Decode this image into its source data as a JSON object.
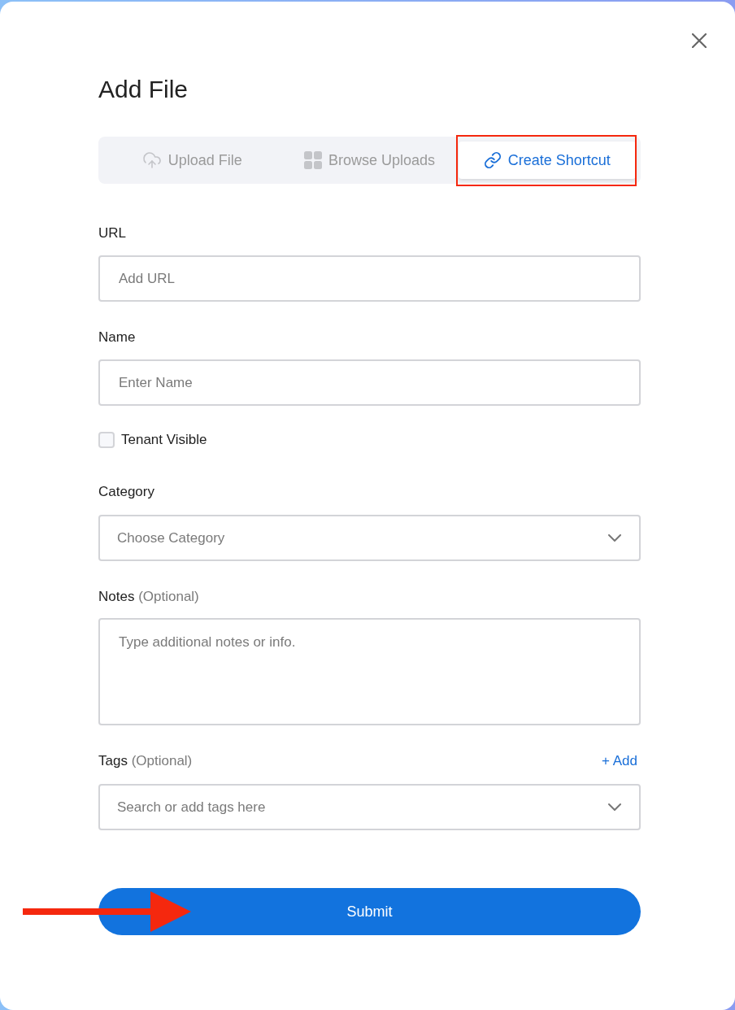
{
  "dialog": {
    "title": "Add File"
  },
  "tabs": [
    {
      "label": "Upload File",
      "selected": false,
      "highlighted": false
    },
    {
      "label": "Browse Uploads",
      "selected": false,
      "highlighted": false
    },
    {
      "label": "Create Shortcut",
      "selected": true,
      "highlighted": true
    }
  ],
  "fields": [
    {
      "kind": "text",
      "label": "URL",
      "placeholder": "Add URL"
    },
    {
      "kind": "text",
      "label": "Name",
      "placeholder": "Enter Name"
    },
    {
      "kind": "checkbox",
      "label": "Tenant Visible",
      "checked": false
    },
    {
      "kind": "select",
      "label": "Category",
      "placeholder": "Choose Category"
    },
    {
      "kind": "textarea",
      "label": "Notes",
      "hint": "(Optional)",
      "placeholder": "Type additional notes or info."
    },
    {
      "kind": "select",
      "label": "Tags",
      "hint": "(Optional)",
      "action": "+ Add",
      "placeholder": "Search or add tags here"
    }
  ],
  "submit": {
    "label": "Submit",
    "arrow_marker": true
  }
}
